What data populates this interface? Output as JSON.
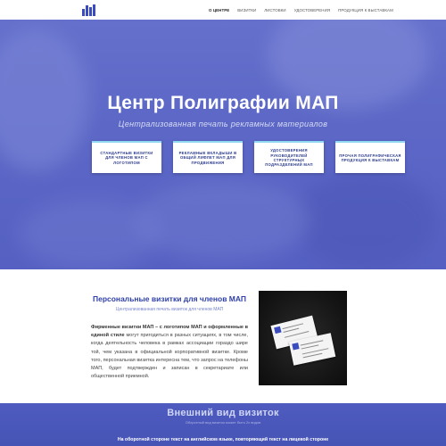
{
  "header": {
    "nav": [
      {
        "label": "О ЦЕНТРЕ",
        "active": true
      },
      {
        "label": "ВИЗИТКИ",
        "active": false
      },
      {
        "label": "ЛИСТОВКИ",
        "active": false
      },
      {
        "label": "УДОСТОВЕРЕНИЯ",
        "active": false
      },
      {
        "label": "ПРОДУКЦИЯ К ВЫСТАВКАМ",
        "active": false
      }
    ]
  },
  "hero": {
    "title": "Центр Полиграфии МАП",
    "subtitle": "Централизованная печать рекламных материалов",
    "cards": [
      {
        "label": "Стандартные визитки для членов МАП с логотипом"
      },
      {
        "label": "Рекламные вкладыши в общий лифлет МАП для продвижения"
      },
      {
        "label": "Удостоверения руководителей структурных подразделений МАП"
      },
      {
        "label": "Прочая полиграфическая продукция к выставкам"
      }
    ]
  },
  "content": {
    "title": "Персональные визитки для членов МАП",
    "subtitle": "Централизованная печать визиток для членов МАП",
    "text_bold": "Фирменные визитки МАП – с логотипом МАП и оформленные в единой стиле",
    "text_rest": " могут пригодиться в разных ситуациях, в том числе, когда деятельность человека в рамках ассоциации гораздо шире той, чем указана в официальной корпоративной визитке. Кроме того, персональная визитка интересна тем, что запрос на телефоны МАП, будет подтвержден и записан в секретариате или общественной приемной."
  },
  "band": {
    "title": "Внешний вид визиток",
    "subtitle": "Оборотный вид визиток может быть 2х видов",
    "text": "На оборотной стороне текст на английском языке, повторяющий текст на лицевой стороне"
  },
  "colors": {
    "brand": "#3a4bbd",
    "hero_bg": "#5c67c6",
    "accent_border": "#8fd7f0",
    "title_blue": "#2f41a8"
  }
}
